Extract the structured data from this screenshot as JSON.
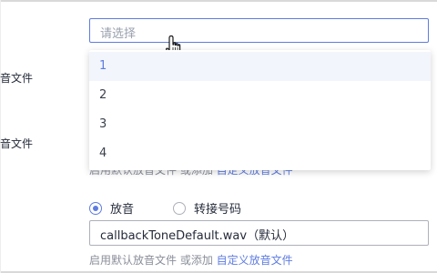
{
  "labels": {
    "audio_file_1": "音文件",
    "audio_file_2": "音文件"
  },
  "select": {
    "placeholder": "请选择",
    "options": [
      "1",
      "2",
      "3",
      "4"
    ]
  },
  "hidden_hint": {
    "text": "启用默认放音文件 或添加 ",
    "link": "自定义放音文件"
  },
  "radio_options": {
    "play": "放音",
    "transfer": "转接号码",
    "selected": "放音"
  },
  "audio_input": {
    "value": "callbackToneDefault.wav（默认）"
  },
  "hint": {
    "text": "启用默认放音文件 或添加 ",
    "link": "自定义放音文件"
  },
  "colors": {
    "accent": "#5e7ce0",
    "highlight_bg": "#f2f5fc",
    "hint_text": "#8a8e99"
  },
  "icons": {
    "cursor": "hand-pointer-icon"
  }
}
